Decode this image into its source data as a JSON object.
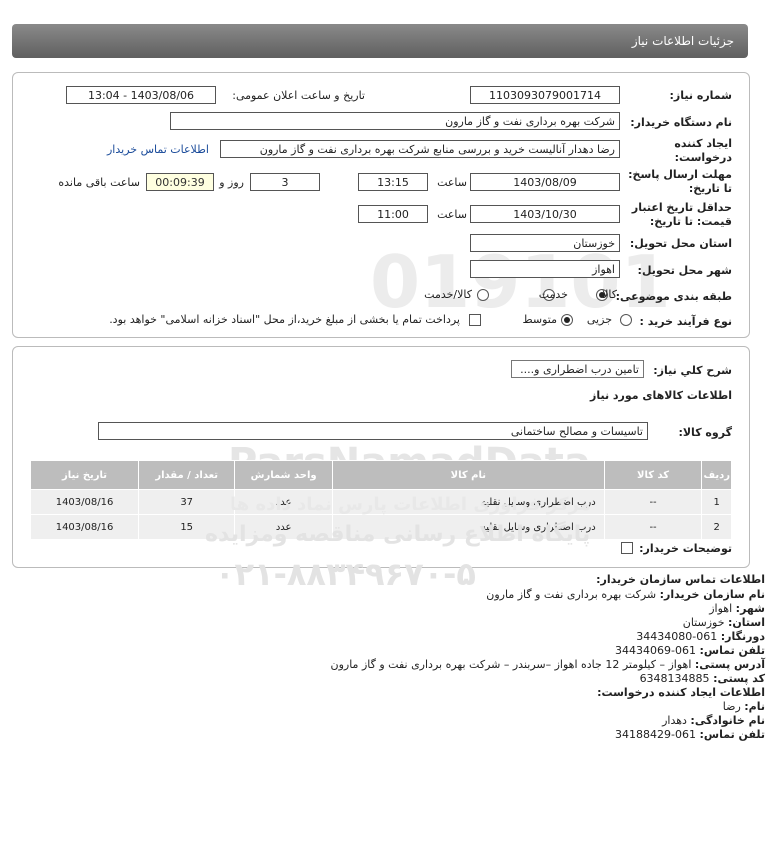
{
  "header": {
    "title": "جزئیات اطلاعات نیاز"
  },
  "form": {
    "need_number_label": "شماره نیاز:",
    "need_number": "1103093079001714",
    "announce_label": "تاریخ و ساعت اعلان عمومی:",
    "announce_value": "1403/08/06 - 13:04",
    "buyer_org_label": "نام دستگاه خریدار:",
    "buyer_org": "شرکت بهره برداری نفت و گاز مارون",
    "creator_label_1": "ایجاد کننده",
    "creator_label_2": "درخواست:",
    "creator": "رضا دهدار آنالیست خرید و بررسی منابع شرکت بهره برداری نفت و گاز مارون",
    "contact_link": "اطلاعات تماس خریدار",
    "deadline_label_1": "مهلت ارسال پاسخ:",
    "deadline_label_2": "تا تاریخ:",
    "deadline_date": "1403/08/09",
    "time_label": "ساعت",
    "deadline_time": "13:15",
    "days_value": "3",
    "days_label": "روز و",
    "timer_value": "00:09:39",
    "remaining_label": "ساعت باقی مانده",
    "validity_label_1": "حداقل تاریخ اعتبار",
    "validity_label_2": "قیمت: تا تاریخ:",
    "validity_date": "1403/10/30",
    "validity_time": "11:00",
    "province_label": "استان محل تحویل:",
    "province": "خوزستان",
    "city_label": "شهر محل تحویل:",
    "city": "اهواز",
    "category_label": "طبقه بندی موضوعی:",
    "category_options": [
      "کالا",
      "خدمت",
      "کالا/خدمت"
    ],
    "process_label": "نوع فرآیند خرید :",
    "process_options": [
      "جزیی",
      "متوسط"
    ],
    "payment_note": "پرداخت تمام یا بخشی از مبلغ خرید،از محل \"اسناد خزانه اسلامی\" خواهد بود."
  },
  "summary": {
    "desc_label": "شرح کلي نياز:",
    "desc": "تامین درب اضطراری و....",
    "goods_info_title": "اطلاعات کالاهای مورد نیاز",
    "group_label": "گروه کالا:",
    "group": "تاسیسات و مصالح ساختمانی"
  },
  "table": {
    "headers": [
      "ردیف",
      "کد کالا",
      "نام کالا",
      "واحد شمارش",
      "تعداد / مقدار",
      "تاریخ نیاز"
    ],
    "rows": [
      [
        "1",
        "--",
        "درب اضطراری وسایل نقلیه",
        "عدد",
        "37",
        "1403/08/16"
      ],
      [
        "2",
        "--",
        "درب اضطراری وسایل نقلیه",
        "عدد",
        "15",
        "1403/08/16"
      ]
    ]
  },
  "buyer_notes_label": "توضیحات خریدار:",
  "contact": {
    "title": "اطلاعات تماس سازمان خریدار:",
    "org_label": "نام سازمان خریدار:",
    "org": "شرکت بهره برداری نفت و گاز مارون",
    "city_label": "شهر:",
    "city": "اهواز",
    "province_label": "استان:",
    "province": "خوزستان",
    "fax_label": "دورنگار:",
    "fax": "061-34434080",
    "phone_label": "تلفن تماس:",
    "phone": "061-34434069",
    "address_label": "آدرس پستی:",
    "address": "اهواز – کیلومتر 12 جاده اهواز –سربندر – شرکت بهره برداری نفت و گاز مارون",
    "postal_label": "کد پستی:",
    "postal": "6348134885",
    "creator_title": "اطلاعات ایجاد کننده درخواست:",
    "name_label": "نام:",
    "name": "رضا",
    "family_label": "نام خانوادگی:",
    "family": "دهدار",
    "creator_phone_label": "تلفن تماس:",
    "creator_phone": "061-34188429"
  },
  "watermark": {
    "brand": "ParsNamadData",
    "line1": "مرکز فراوری اطلاعات پارس نماد داده ها",
    "line2": "پایگاه اطلاع رسانی مناقصه ومزایده",
    "phone": "۰۲۱-۸۸۳۴۹۶۷۰-۵"
  }
}
